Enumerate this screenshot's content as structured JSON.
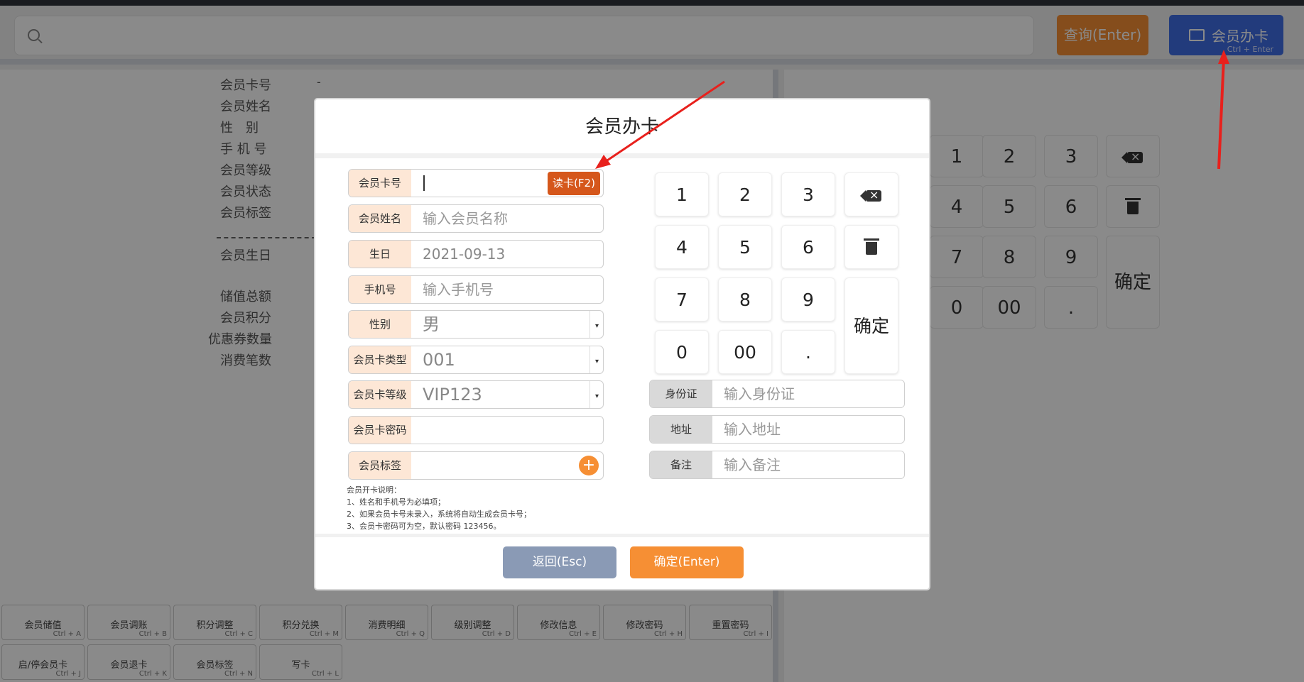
{
  "header": {
    "query_label": "查询(Enter)",
    "card_label": "会员办卡",
    "card_shortcut": "Ctrl + Enter"
  },
  "member_info": {
    "labels": [
      "会员卡号",
      "会员姓名",
      "性　别",
      "手 机 号",
      "会员等级",
      "会员状态",
      "会员标签",
      "会员生日",
      "储值总额",
      "会员积分",
      "优惠券数量",
      "消费笔数"
    ],
    "card_no_value": "-"
  },
  "function_keys": [
    {
      "label": "会员储值",
      "shortcut": "Ctrl + A"
    },
    {
      "label": "会员调账",
      "shortcut": "Ctrl + B"
    },
    {
      "label": "积分调整",
      "shortcut": "Ctrl + C"
    },
    {
      "label": "积分兑换",
      "shortcut": "Ctrl + M"
    },
    {
      "label": "消费明细",
      "shortcut": "Ctrl + Q"
    },
    {
      "label": "级别调整",
      "shortcut": "Ctrl + D"
    },
    {
      "label": "修改信息",
      "shortcut": "Ctrl + E"
    },
    {
      "label": "修改密码",
      "shortcut": "Ctrl + H"
    },
    {
      "label": "重置密码",
      "shortcut": "Ctrl + I"
    },
    {
      "label": "启/停会员卡",
      "shortcut": "Ctrl + J"
    },
    {
      "label": "会员退卡",
      "shortcut": "Ctrl + K"
    },
    {
      "label": "会员标签",
      "shortcut": "Ctrl + N"
    },
    {
      "label": "写卡",
      "shortcut": "Ctrl + L"
    }
  ],
  "right_keypad": {
    "keys": [
      "1",
      "2",
      "3",
      "4",
      "5",
      "6",
      "7",
      "8",
      "9",
      "0",
      "00",
      "."
    ],
    "confirm": "确定"
  },
  "modal": {
    "title": "会员办卡",
    "fields": {
      "card_no": {
        "label": "会员卡号",
        "value": ""
      },
      "read_card": "读卡(F2)",
      "name": {
        "label": "会员姓名",
        "placeholder": "输入会员名称"
      },
      "birthday": {
        "label": "生日",
        "value": "2021-09-13"
      },
      "phone": {
        "label": "手机号",
        "placeholder": "输入手机号"
      },
      "gender": {
        "label": "性别",
        "value": "男"
      },
      "card_type": {
        "label": "会员卡类型",
        "value": "001"
      },
      "card_level": {
        "label": "会员卡等级",
        "value": "VIP123"
      },
      "card_password": {
        "label": "会员卡密码",
        "value": ""
      },
      "tags": {
        "label": "会员标签",
        "value": ""
      },
      "id_card": {
        "label": "身份证",
        "placeholder": "输入身份证"
      },
      "address": {
        "label": "地址",
        "placeholder": "输入地址"
      },
      "remark": {
        "label": "备注",
        "placeholder": "输入备注"
      }
    },
    "notes": [
      "会员开卡说明：",
      "1、姓名和手机号为必填项；",
      "2、如果会员卡号未录入，系统将自动生成会员卡号；",
      "3、会员卡密码可为空，默认密码 123456。"
    ],
    "keypad": {
      "keys": [
        "1",
        "2",
        "3",
        "4",
        "5",
        "6",
        "7",
        "8",
        "9",
        "0",
        "00",
        "."
      ],
      "confirm": "确定"
    },
    "back_label": "返回(Esc)",
    "ok_label": "确定(Enter)"
  },
  "colors": {
    "accent_orange": "#f68f34",
    "accent_blue": "#3f6ee6",
    "read_card": "#d5571b",
    "annotation_red": "#e8201c"
  }
}
